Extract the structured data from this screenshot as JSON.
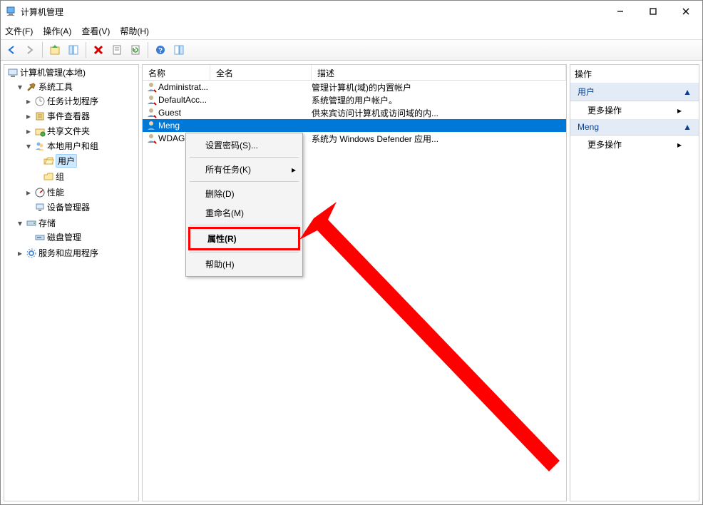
{
  "window": {
    "title": "计算机管理"
  },
  "menu": {
    "file": "文件(F)",
    "action": "操作(A)",
    "view": "查看(V)",
    "help": "帮助(H)"
  },
  "tree": {
    "root": "计算机管理(本地)",
    "system_tools": "系统工具",
    "task_scheduler": "任务计划程序",
    "event_viewer": "事件查看器",
    "shared_folders": "共享文件夹",
    "local_users": "本地用户和组",
    "users": "用户",
    "groups": "组",
    "performance": "性能",
    "device_manager": "设备管理器",
    "storage": "存储",
    "disk_mgmt": "磁盘管理",
    "services_apps": "服务和应用程序"
  },
  "list": {
    "headers": {
      "name": "名称",
      "full": "全名",
      "desc": "描述"
    },
    "rows": [
      {
        "name": "Administrat...",
        "desc": "管理计算机(域)的内置帐户"
      },
      {
        "name": "DefaultAcc...",
        "desc": "系统管理的用户帐户。"
      },
      {
        "name": "Guest",
        "desc": "供来宾访问计算机或访问域的内..."
      },
      {
        "name": "Meng",
        "desc": ""
      },
      {
        "name": "WDAG...",
        "desc": "系统为 Windows Defender 应用..."
      }
    ]
  },
  "ctx": {
    "set_pwd": "设置密码(S)...",
    "all_tasks": "所有任务(K)",
    "delete": "删除(D)",
    "rename": "重命名(M)",
    "properties": "属性(R)",
    "help": "帮助(H)"
  },
  "actions": {
    "title": "操作",
    "users": "用户",
    "more": "更多操作",
    "selected": "Meng"
  }
}
